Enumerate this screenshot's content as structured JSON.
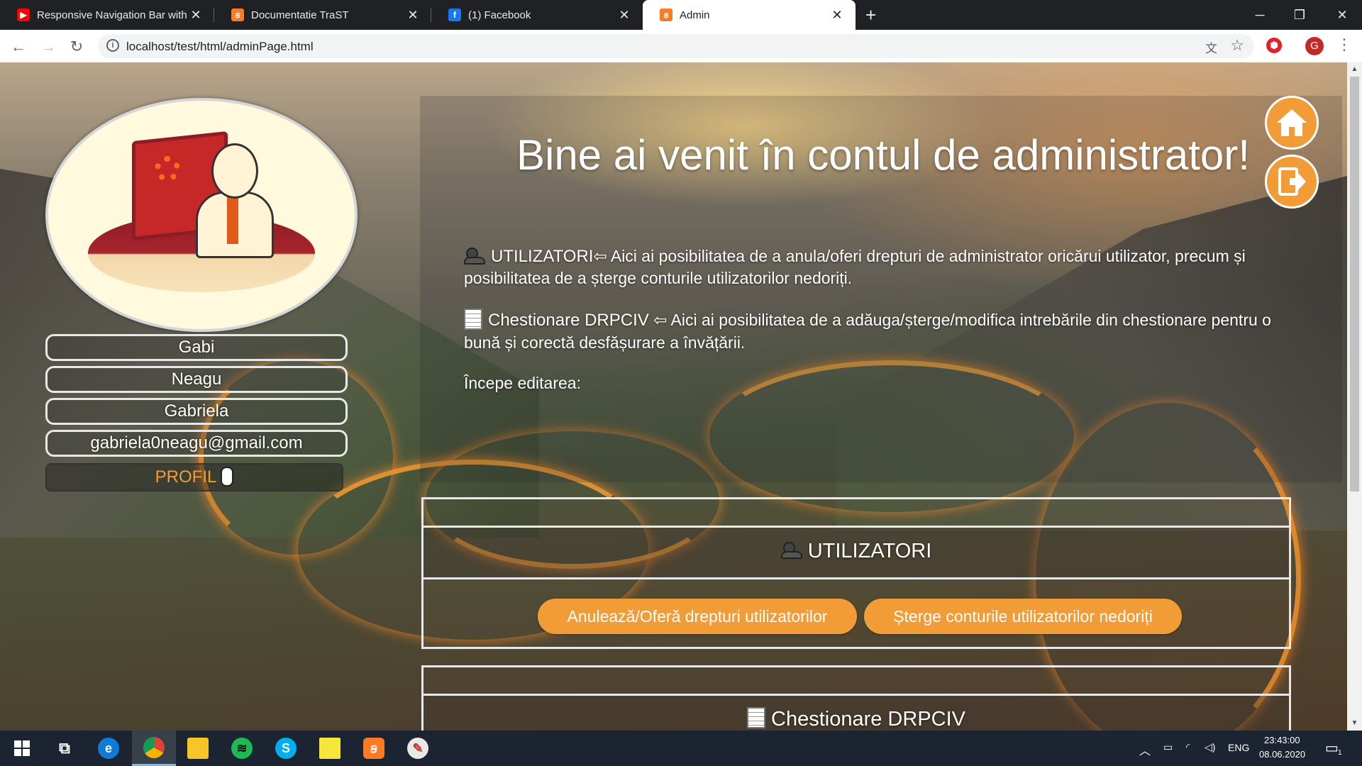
{
  "browser": {
    "tabs": [
      {
        "title": "Responsive Navigation Bar with I",
        "icon": "youtube-icon",
        "color": "#ff0000"
      },
      {
        "title": "Documentatie TraST",
        "icon": "xampp-icon",
        "color": "#fb7a24"
      },
      {
        "title": "(1) Facebook",
        "icon": "facebook-icon",
        "color": "#1877f2"
      },
      {
        "title": "Admin",
        "icon": "xampp-icon",
        "color": "#fb7a24"
      }
    ],
    "url": "localhost/test/html/adminPage.html",
    "profile_initial": "G"
  },
  "profile": {
    "last_name": "Gabi",
    "first_name": "Neagu",
    "name_extra": "Gabriela",
    "email": "gabriela0neagu@gmail.com",
    "profile_label": "PROFIL"
  },
  "main": {
    "title": "Bine ai venit în contul de administrator!",
    "paragraph1_head": "UTILIZATORI",
    "paragraph1_text": "⇦ Aici ai posibilitatea de a anula/oferi drepturi de administrator oricărui utilizator, precum și posibilitatea de a șterge conturile utilizatorilor nedoriți.",
    "paragraph2_head": "Chestionare DRPCIV",
    "paragraph2_text": "⇦ Aici ai posibilitatea de a adăuga/șterge/modifica intrebările din chestionare pentru o bună și corectă desfășurare a învățării.",
    "start_label": "Începe editarea:",
    "section1": {
      "title": "UTILIZATORI",
      "btn_rights": "Anulează/Oferă drepturi utilizatorilor",
      "btn_delete": "Șterge conturile utilizatorilor nedoriți"
    },
    "section2": {
      "title": "Chestionare DRPCIV"
    }
  },
  "colors": {
    "accent": "#f29c38"
  },
  "taskbar": {
    "language": "ENG",
    "time": "23:43:00",
    "date": "08.06.2020",
    "notifications": "1"
  }
}
